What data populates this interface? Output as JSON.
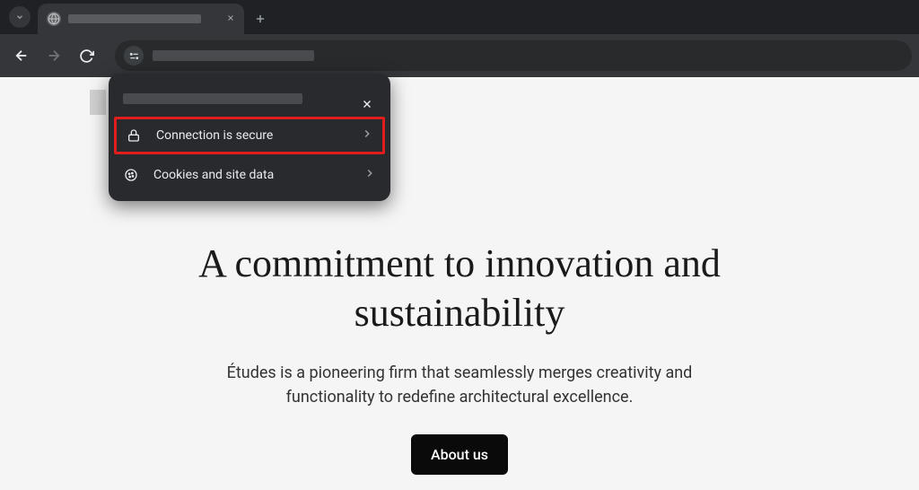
{
  "browser": {
    "tab": {
      "title_obscured": true
    },
    "address_bar": {
      "url_obscured": true
    }
  },
  "popup": {
    "header_obscured": true,
    "rows": [
      {
        "icon": "lock",
        "label": "Connection is secure",
        "highlighted": true
      },
      {
        "icon": "cookie",
        "label": "Cookies and site data",
        "highlighted": false
      }
    ]
  },
  "page": {
    "title": "A commitment to innovation and sustainability",
    "subtitle": "Études is a pioneering firm that seamlessly merges creativity and functionality to redefine architectural excellence.",
    "cta_label": "About us"
  }
}
